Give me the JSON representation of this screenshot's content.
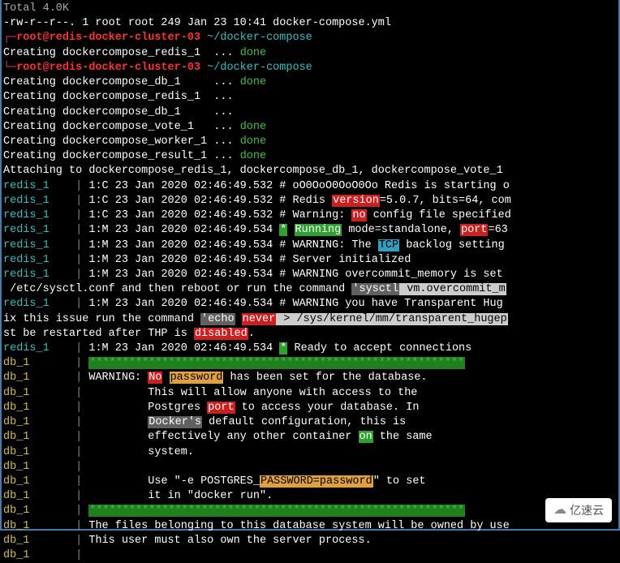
{
  "header": {
    "total": "Total 4.0K",
    "ls_line": "-rw-r--r--. 1 root root 249 Jan 23 10:41 docker-compose.yml",
    "prompt1_user": "root@redis-docker-cluster-03",
    "prompt1_path": "~/docker-compose",
    "prompt2_user": "root@redis-docker-cluster-03",
    "prompt2_path": "~/docker-compose"
  },
  "creating": [
    {
      "name": "dockercompose_redis_1 ",
      "dots": "...",
      "status": "done"
    },
    {
      "name": "dockercompose_db_1    ",
      "dots": "...",
      "status": "done"
    },
    {
      "name": "dockercompose_redis_1 ",
      "dots": "...",
      "status": ""
    },
    {
      "name": "dockercompose_db_1    ",
      "dots": "...",
      "status": ""
    },
    {
      "name": "dockercompose_vote_1  ",
      "dots": "...",
      "status": "done"
    },
    {
      "name": "dockercompose_worker_1",
      "dots": "...",
      "status": "done"
    },
    {
      "name": "dockercompose_result_1",
      "dots": "...",
      "status": "done"
    }
  ],
  "attaching": "Attaching to dockercompose_redis_1, dockercompose_db_1, dockercompose_vote_1",
  "redis_lines": [
    {
      "svc": "redis_1",
      "text": "1:C 23 Jan 2020 02:46:49.532 # oO0OoO0OoO0Oo Redis is starting o"
    },
    {
      "svc": "redis_1",
      "text": "1:C 23 Jan 2020 02:46:49.532 # Redis ",
      "hl1": "version",
      "hl1_cls": "hl-red",
      "text2": "=5.0.7, bits=64, com"
    },
    {
      "svc": "redis_1",
      "text": "1:C 23 Jan 2020 02:46:49.532 # Warning: ",
      "hl1": "no",
      "hl1_cls": "hl-red",
      "text2": " config file specified"
    },
    {
      "svc": "redis_1",
      "text": "1:M 23 Jan 2020 02:46:49.534 ",
      "star": "*",
      "text_a": " ",
      "hl1": "Running",
      "hl1_cls": "hl-green",
      "text2": " mode=standalone, ",
      "hl2": "port",
      "hl2_cls": "hl-red",
      "text3": "=63"
    },
    {
      "svc": "redis_1",
      "text": "1:M 23 Jan 2020 02:46:49.534 # WARNING: The ",
      "hl1": "TCP",
      "hl1_cls": "hl-cyan",
      "text2": " backlog setting "
    },
    {
      "svc": "redis_1",
      "text": "1:M 23 Jan 2020 02:46:49.534 # Server initialized"
    },
    {
      "svc": "redis_1",
      "text": "1:M 23 Jan 2020 02:46:49.534 # WARNING overcommit_memory is set"
    }
  ],
  "sysctl_line": {
    "text1": " /etc/sysctl.conf and then reboot or run the command ",
    "hl1": "'sysctl",
    "text2": " vm.overcommit_m"
  },
  "redis_warn2": {
    "svc": "redis_1",
    "text": "1:M 23 Jan 2020 02:46:49.534 # WARNING you have Transparent Hug"
  },
  "echo_line": {
    "text1": "ix this issue run the command ",
    "hl1": "'echo",
    "hl2": "never",
    "text2": " > /sys/kernel/mm/transparent_hugep"
  },
  "restart_line": {
    "text1": "st be restarted after THP is ",
    "hl1": "disabled",
    "text2": "."
  },
  "redis_ready": {
    "svc": "redis_1",
    "text": "1:M 23 Jan 2020 02:46:49.534 ",
    "star": "*",
    "text2": " Ready to accept connections"
  },
  "db_stars1": "*********************************************************",
  "db_warn": {
    "l1_a": "WARNING: ",
    "l1_no": "No",
    "l1_pw": "password",
    "l1_b": " has been set for the database.",
    "l2": "         This will allow anyone with access to the",
    "l3_a": "         Postgres ",
    "l3_port": "port",
    "l3_b": " to access your database. In",
    "l4_a": "         ",
    "l4_docker": "Docker's",
    "l4_b": " default configuration, this is",
    "l5_a": "         effectively any other container ",
    "l5_on": "on",
    "l5_b": " the same",
    "l6": "         system.",
    "l7": "",
    "l8_a": "         Use \"-e POSTGRES_",
    "l8_pw": "PASSWORD=password",
    "l8_b": "\" to set",
    "l9": "         it in \"docker run\"."
  },
  "db_stars2": "*********************************************************",
  "db_files": {
    "l1": "The files belonging to this database system will be owned by use",
    "l2": "This user must also own the server process.",
    "l3": ""
  },
  "db_label": "db_1",
  "watermark": "亿速云"
}
